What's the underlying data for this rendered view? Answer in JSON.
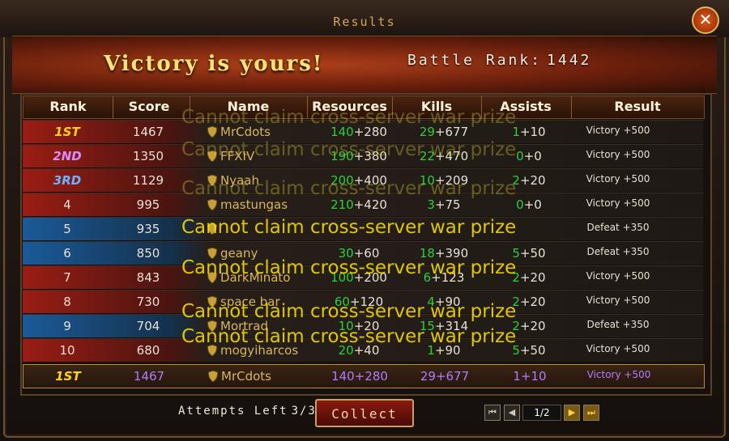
{
  "window": {
    "title": "Results",
    "close_label": "✕"
  },
  "banner": {
    "victory_text": "Victory is yours!",
    "battle_rank_label": "Battle Rank:",
    "battle_rank_value": "1442"
  },
  "columns": {
    "rank": "Rank",
    "score": "Score",
    "name": "Name",
    "resources": "Resources",
    "kills": "Kills",
    "assists": "Assists",
    "result": "Result"
  },
  "rows": [
    {
      "rank": "1ST",
      "rank_color": "#ffd21a",
      "score": "1467",
      "name": "MrCdots",
      "res_a": "140",
      "res_b": "+280",
      "kill_a": "29",
      "kill_b": "+677",
      "as_a": "1",
      "as_b": "+10",
      "result": "Victory +500",
      "team": "red"
    },
    {
      "rank": "2ND",
      "rank_color": "#d88cff",
      "score": "1350",
      "name": "FFXIV",
      "res_a": "190",
      "res_b": "+380",
      "kill_a": "22",
      "kill_b": "+470",
      "as_a": "0",
      "as_b": "+0",
      "result": "Victory +500",
      "team": "red"
    },
    {
      "rank": "3RD",
      "rank_color": "#6ab4ff",
      "score": "1129",
      "name": "Nyaah",
      "res_a": "200",
      "res_b": "+400",
      "kill_a": "10",
      "kill_b": "+209",
      "as_a": "2",
      "as_b": "+20",
      "result": "Victory +500",
      "team": "red"
    },
    {
      "rank": "4",
      "rank_color": "#e8e0d2",
      "score": "995",
      "name": "mastungas",
      "res_a": "210",
      "res_b": "+420",
      "kill_a": "3",
      "kill_b": "+75",
      "as_a": "0",
      "as_b": "+0",
      "result": "Victory +500",
      "team": "red"
    },
    {
      "rank": "5",
      "rank_color": "#e8e0d2",
      "score": "935",
      "name": "",
      "res_a": "",
      "res_b": "",
      "kill_a": "",
      "kill_b": "",
      "as_a": "",
      "as_b": "",
      "result": "Defeat +350",
      "team": "blue"
    },
    {
      "rank": "6",
      "rank_color": "#e8e0d2",
      "score": "850",
      "name": "geany",
      "res_a": "30",
      "res_b": "+60",
      "kill_a": "18",
      "kill_b": "+390",
      "as_a": "5",
      "as_b": "+50",
      "result": "Defeat +350",
      "team": "blue"
    },
    {
      "rank": "7",
      "rank_color": "#e8e0d2",
      "score": "843",
      "name": "DarkMinato",
      "res_a": "100",
      "res_b": "+200",
      "kill_a": "6",
      "kill_b": "+123",
      "as_a": "2",
      "as_b": "+20",
      "result": "Victory +500",
      "team": "red"
    },
    {
      "rank": "8",
      "rank_color": "#e8e0d2",
      "score": "730",
      "name": "space bar",
      "res_a": "60",
      "res_b": "+120",
      "kill_a": "4",
      "kill_b": "+90",
      "as_a": "2",
      "as_b": "+20",
      "result": "Victory +500",
      "team": "red"
    },
    {
      "rank": "9",
      "rank_color": "#e8e0d2",
      "score": "704",
      "name": "Mortrad",
      "res_a": "10",
      "res_b": "+20",
      "kill_a": "15",
      "kill_b": "+314",
      "as_a": "2",
      "as_b": "+20",
      "result": "Defeat +350",
      "team": "blue"
    },
    {
      "rank": "10",
      "rank_color": "#e8e0d2",
      "score": "680",
      "name": "mogyiharcos",
      "res_a": "20",
      "res_b": "+40",
      "kill_a": "1",
      "kill_b": "+90",
      "as_a": "5",
      "as_b": "+50",
      "result": "Victory +500",
      "team": "red"
    }
  ],
  "self_row": {
    "rank": "1ST",
    "score": "1467",
    "name": "MrCdots",
    "res_a": "140",
    "res_b": "+280",
    "kill_a": "29",
    "kill_b": "+677",
    "as_a": "1",
    "as_b": "+10",
    "result": "Victory +500"
  },
  "overlay_message": "Cannot claim cross-server war prize",
  "footer": {
    "attempts_label": "Attempts Left",
    "attempts_value": "3/3",
    "collect_label": "Collect",
    "page_info": "1/2"
  },
  "colors": {
    "green": "#2ecf3a",
    "gold": "#ffd24a",
    "self_purple": "#b07cff",
    "overlay_yellow": "#ffe400"
  }
}
